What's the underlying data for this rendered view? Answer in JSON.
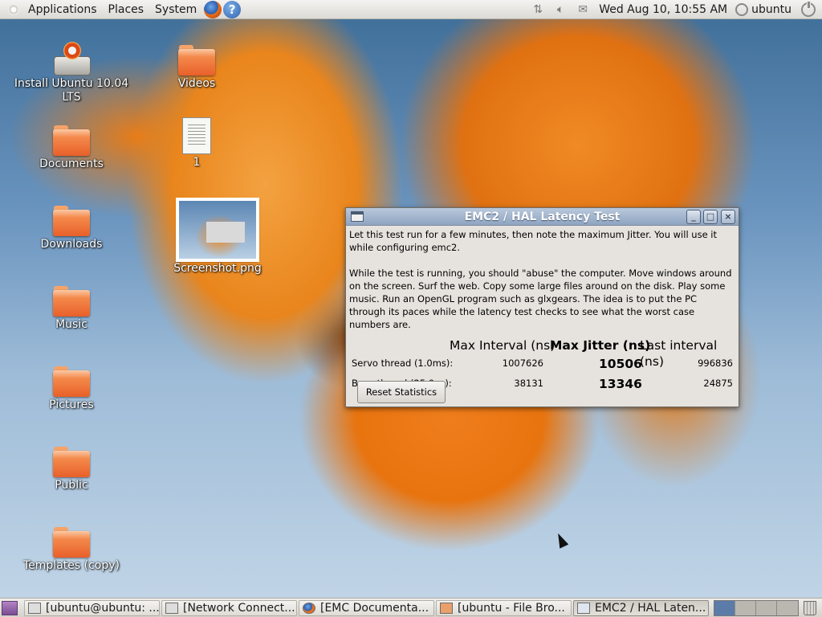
{
  "top_panel": {
    "menus": [
      "Applications",
      "Places",
      "System"
    ],
    "help_glyph": "?",
    "clock": "Wed Aug 10, 10:55 AM",
    "user": "ubuntu",
    "icons": [
      "gnome-foot-icon",
      "firefox-icon",
      "help-icon",
      "network-icon",
      "volume-icon",
      "mail-icon",
      "user-icon",
      "power-icon"
    ]
  },
  "desktop": {
    "icons": [
      {
        "label": "Install Ubuntu 10.04 LTS",
        "kind": "installer-icon"
      },
      {
        "label": "Videos",
        "kind": "folder-icon"
      },
      {
        "label": "Documents",
        "kind": "folder-icon"
      },
      {
        "label": "1",
        "kind": "text-file-icon"
      },
      {
        "label": "Screenshot.png",
        "kind": "image-file-icon"
      },
      {
        "label": "Downloads",
        "kind": "folder-icon"
      },
      {
        "label": "Music",
        "kind": "folder-icon"
      },
      {
        "label": "Pictures",
        "kind": "folder-icon"
      },
      {
        "label": "Public",
        "kind": "folder-icon"
      },
      {
        "label": "Templates (copy)",
        "kind": "folder-icon"
      }
    ]
  },
  "latency_window": {
    "title": "EMC2 / HAL Latency Test",
    "intro": "Let this test run for a few minutes, then note the maximum Jitter.  You will use it while configuring emc2.",
    "instructions": "While the test is running, you should \"abuse\" the computer. Move windows around on the screen. Surf the web. Copy some large files around on the disk. Play some music. Run an OpenGL program such as glxgears. The idea is to put the PC through its paces while the latency test checks to see what the worst case numbers are.",
    "headers": {
      "max_interval": "Max Interval (ns)",
      "max_jitter": "Max Jitter (ns)",
      "last_interval": "Last interval (ns)"
    },
    "rows": [
      {
        "label": "Servo thread (1.0ms):",
        "max_interval": "1007626",
        "max_jitter": "10506",
        "last_interval": "996836"
      },
      {
        "label": "Base thread (25.0µs):",
        "max_interval": "38131",
        "max_jitter": "13346",
        "last_interval": "24875"
      }
    ],
    "reset_label": "Reset Statistics",
    "buttons": {
      "minimize": "_",
      "maximize": "□",
      "close": "×"
    }
  },
  "bottom_panel": {
    "tasks": [
      {
        "label": "[ubuntu@ubuntu: ...",
        "icon": "terminal-icon"
      },
      {
        "label": "[Network Connect...",
        "icon": "network-icon"
      },
      {
        "label": "[EMC Documenta...",
        "icon": "firefox-icon"
      },
      {
        "label": "[ubuntu - File Bro...",
        "icon": "file-browser-icon"
      },
      {
        "label": "EMC2 / HAL Laten...",
        "icon": "window-icon",
        "active": true
      }
    ],
    "workspaces": 4,
    "current_workspace": 1
  },
  "colors": {
    "panel": "#dcdad5",
    "window_title": "#8ea4c1",
    "window_body": "#e6e3de",
    "folder": "#e8602a",
    "sky": "#6b95bf",
    "flower": "#e9851c"
  }
}
